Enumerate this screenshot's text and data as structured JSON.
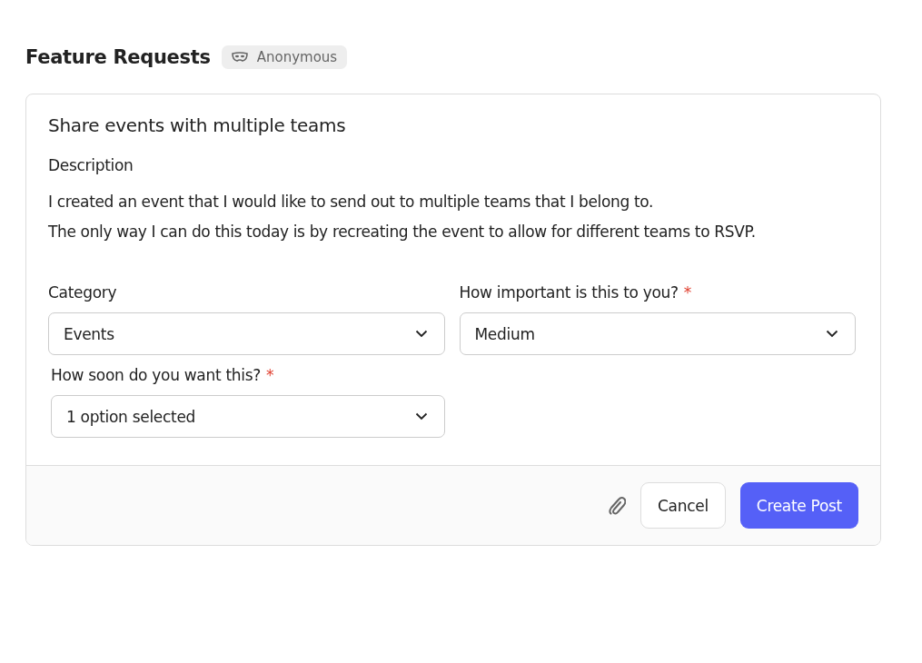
{
  "header": {
    "title": "Feature Requests",
    "badge": "Anonymous"
  },
  "post": {
    "title": "Share events with multiple teams",
    "description_label": "Description",
    "description": [
      "I created an event that I would like to send out to multiple teams that I belong to.",
      "The only way I can do this today is by recreating the event to allow for different teams to RSVP."
    ],
    "fields": [
      {
        "label": "Category",
        "value": "Events"
      },
      {
        "label": "How important is this to you?",
        "required_mark": "*",
        "value": "Medium"
      },
      {
        "label": "How soon do you want this?",
        "required_mark": "*",
        "value": "1 option selected"
      }
    ]
  },
  "footer": {
    "buttons": [
      {
        "label": "Cancel",
        "kind": "secondary"
      },
      {
        "label": "Create Post",
        "kind": "primary"
      }
    ]
  }
}
